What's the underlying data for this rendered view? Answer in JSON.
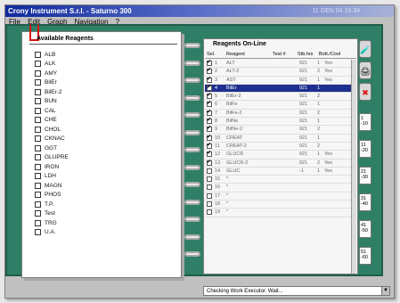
{
  "window": {
    "title": "Crony Instrument S.r.l. - Saturno 300",
    "title_right": "11 GEN 04 18.34"
  },
  "menu": {
    "items": [
      "File",
      "Edit",
      "Graph",
      "Navigation",
      "?"
    ]
  },
  "available": {
    "title": "Available Reagents",
    "items": [
      "ALB",
      "ALK",
      "AMY",
      "BilEr",
      "BilEr-2",
      "BUN",
      "CAL",
      "CHE",
      "CHOL",
      "CKNAC",
      "GGT",
      "GLUPRE",
      "IRON",
      "LDH",
      "MAGN",
      "PHOS",
      "T.P.",
      "Test",
      "TRG",
      "U.A."
    ]
  },
  "online": {
    "title": "Reagents On-Line",
    "headers": {
      "sel": "Sel.",
      "reagent": "Reagent",
      "test": "Test #",
      "stb": "Stb.hrs",
      "bottle": "Bott./Cool"
    },
    "rows": [
      {
        "n": "1",
        "reagent": "ALT",
        "stb": "921",
        "bott": "1",
        "cool": "Yes",
        "checked": true,
        "selected": false
      },
      {
        "n": "2",
        "reagent": "ALT-2",
        "stb": "921",
        "bott": "2",
        "cool": "Yes",
        "checked": true,
        "selected": false
      },
      {
        "n": "3",
        "reagent": "AST",
        "stb": "921",
        "bott": "1",
        "cool": "Yes",
        "checked": true,
        "selected": false
      },
      {
        "n": "4",
        "reagent": "BilEr",
        "stb": "921",
        "bott": "1",
        "cool": "",
        "checked": true,
        "selected": true
      },
      {
        "n": "5",
        "reagent": "BilEr-2",
        "stb": "921",
        "bott": "2",
        "cool": "",
        "checked": true,
        "selected": false
      },
      {
        "n": "6",
        "reagent": "BilFe",
        "stb": "921",
        "bott": "1",
        "cool": "",
        "checked": true,
        "selected": false
      },
      {
        "n": "7",
        "reagent": "BilFe-2",
        "stb": "921",
        "bott": "2",
        "cool": "",
        "checked": true,
        "selected": false
      },
      {
        "n": "8",
        "reagent": "BilNe",
        "stb": "921",
        "bott": "1",
        "cool": "",
        "checked": true,
        "selected": false
      },
      {
        "n": "9",
        "reagent": "BilNe-2",
        "stb": "921",
        "bott": "2",
        "cool": "",
        "checked": true,
        "selected": false
      },
      {
        "n": "10",
        "reagent": "CREAT",
        "stb": "921",
        "bott": "1",
        "cool": "",
        "checked": true,
        "selected": false
      },
      {
        "n": "11",
        "reagent": "CREAT-2",
        "stb": "921",
        "bott": "2",
        "cool": "",
        "checked": true,
        "selected": false
      },
      {
        "n": "12",
        "reagent": "GLUCR",
        "stb": "921",
        "bott": "1",
        "cool": "Yes",
        "checked": true,
        "selected": false
      },
      {
        "n": "13",
        "reagent": "GLUCR-2",
        "stb": "921",
        "bott": "2",
        "cool": "Yes",
        "checked": true,
        "selected": false
      },
      {
        "n": "14",
        "reagent": "GLUC",
        "stb": "-1",
        "bott": "1",
        "cool": "Yes",
        "checked": false,
        "selected": false
      },
      {
        "n": "15",
        "reagent": "*",
        "stb": "",
        "bott": "",
        "cool": "",
        "checked": false,
        "selected": false
      },
      {
        "n": "16",
        "reagent": "*",
        "stb": "",
        "bott": "",
        "cool": "",
        "checked": false,
        "selected": false
      },
      {
        "n": "17",
        "reagent": "*",
        "stb": "",
        "bott": "",
        "cool": "",
        "checked": false,
        "selected": false
      },
      {
        "n": "18",
        "reagent": "*",
        "stb": "",
        "bott": "",
        "cool": "",
        "checked": false,
        "selected": false
      },
      {
        "n": "19",
        "reagent": "*",
        "stb": "",
        "bott": "",
        "cool": "",
        "checked": false,
        "selected": false
      }
    ]
  },
  "tabs": [
    "1\n-10",
    "11\n-20",
    "21\n-30",
    "31\n-40",
    "41\n-50",
    "51\n-60"
  ],
  "tools": [
    "bottle-icon",
    "analyzer-icon",
    "cancel-icon"
  ],
  "status": {
    "text": "Checking Work Executor. Wait..."
  },
  "colors": {
    "desk": "#2e7f66",
    "selection": "#1d2f8f",
    "title_start": "#102a9c"
  }
}
